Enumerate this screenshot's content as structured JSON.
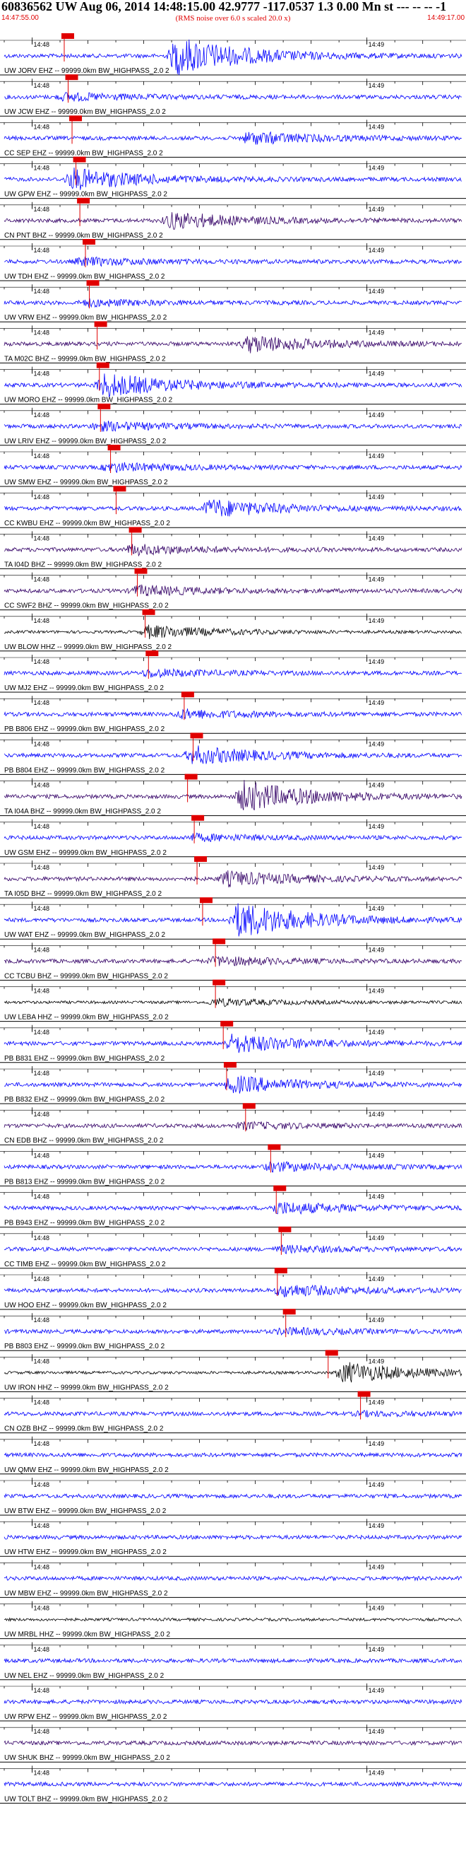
{
  "header": {
    "title": "60836562 UW Aug 06, 2014 14:48:15.00   42.9777 -117.0537  1.3 0.00 Mn st --- -- --  -1",
    "subtitle": "(RMS noise over 6.0 s scaled 20.0 x)",
    "start_time": "14:47:55.00",
    "end_time": "14:49:17.00"
  },
  "colors": {
    "blue": "#0000ff",
    "purple": "#330066",
    "black": "#000000",
    "pick": "#e00000"
  },
  "chart_data": {
    "type": "line",
    "title": "60836562 UW Aug 06, 2014 14:48:15.00   42.9777 -117.0537  1.3 0.00 Mn st --- -- --  -1",
    "subtitle": "(RMS noise over 6.0 s scaled 20.0 x)",
    "x_start": "14:47:55.00",
    "x_end": "14:49:17.00",
    "x_duration_s": 82,
    "minute_labels": [
      "14:48",
      "14:49"
    ],
    "traces": [
      {
        "label": "UW JORV EHZ -- 99999.0km BW_HIGHPASS_2.0 2",
        "color": "blue",
        "pick_s": 10.5,
        "event_s": 31,
        "event_amp": 3.2
      },
      {
        "label": "UW JCW EHZ -- 99999.0km BW_HIGHPASS_2.0 2",
        "color": "blue",
        "pick_s": 11.2,
        "event_s": 11,
        "event_amp": 0.6
      },
      {
        "label": "CC SEP EHZ -- 99999.0km BW_HIGHPASS_2.0 2",
        "color": "blue",
        "pick_s": 11.9,
        "event_s": 44,
        "event_amp": 1.0
      },
      {
        "label": "UW GPW EHZ -- 99999.0km BW_HIGHPASS_2.0 2",
        "color": "blue",
        "pick_s": 12.6,
        "event_s": 12.5,
        "event_amp": 1.8
      },
      {
        "label": "CN PNT BHZ -- 99999.0km BW_HIGHPASS_2.0 2",
        "color": "purple",
        "pick_s": 13.3,
        "event_s": 30,
        "event_amp": 1.4
      },
      {
        "label": "UW TDH EHZ -- 99999.0km BW_HIGHPASS_2.0 2",
        "color": "blue",
        "pick_s": 14.3,
        "event_s": 14,
        "event_amp": 0.6
      },
      {
        "label": "UW VRW EHZ -- 99999.0km BW_HIGHPASS_2.0 2",
        "color": "blue",
        "pick_s": 15.0,
        "event_s": 15,
        "event_amp": 0.5
      },
      {
        "label": "TA M02C BHZ -- 99999.0km BW_HIGHPASS_2.0 2",
        "color": "purple",
        "pick_s": 16.4,
        "event_s": 44,
        "event_amp": 1.4
      },
      {
        "label": "UW MORO EHZ -- 99999.0km BW_HIGHPASS_2.0 2",
        "color": "blue",
        "pick_s": 16.8,
        "event_s": 18,
        "event_amp": 2.0
      },
      {
        "label": "UW LRIV EHZ -- 99999.0km BW_HIGHPASS_2.0 2",
        "color": "blue",
        "pick_s": 17.0,
        "event_s": 17,
        "event_amp": 0.7
      },
      {
        "label": "UW SMW EHZ -- 99999.0km BW_HIGHPASS_2.0 2",
        "color": "blue",
        "pick_s": 18.8,
        "event_s": 19,
        "event_amp": 0.7
      },
      {
        "label": "CC KWBU EHZ -- 99999.0km BW_HIGHPASS_2.0 2",
        "color": "blue",
        "pick_s": 19.8,
        "event_s": 37,
        "event_amp": 1.5
      },
      {
        "label": "TA I04D BHZ -- 99999.0km BW_HIGHPASS_2.0 2",
        "color": "purple",
        "pick_s": 22.6,
        "event_s": 23,
        "event_amp": 0.8
      },
      {
        "label": "CC SWF2 BHZ -- 99999.0km BW_HIGHPASS_2.0 2",
        "color": "purple",
        "pick_s": 23.6,
        "event_s": 24,
        "event_amp": 0.8
      },
      {
        "label": "UW BLOW HHZ -- 99999.0km BW_HIGHPASS_2.0 2",
        "color": "black",
        "pick_s": 25.0,
        "event_s": 26,
        "event_amp": 1.1
      },
      {
        "label": "UW MJ2 EHZ -- 99999.0km BW_HIGHPASS_2.0 2",
        "color": "blue",
        "pick_s": 25.6,
        "event_s": 26,
        "event_amp": 0.6
      },
      {
        "label": "PB B806 EHZ -- 99999.0km BW_HIGHPASS_2.0 2",
        "color": "blue",
        "pick_s": 32.0,
        "event_s": 32,
        "event_amp": 0.7
      },
      {
        "label": "PB B804 EHZ -- 99999.0km BW_HIGHPASS_2.0 2",
        "color": "blue",
        "pick_s": 33.6,
        "event_s": 34,
        "event_amp": 1.5
      },
      {
        "label": "TA I04A BHZ -- 99999.0km BW_HIGHPASS_2.0 2",
        "color": "purple",
        "pick_s": 32.6,
        "event_s": 43,
        "event_amp": 2.6
      },
      {
        "label": "UW GSM EHZ -- 99999.0km BW_HIGHPASS_2.0 2",
        "color": "blue",
        "pick_s": 33.8,
        "event_s": 34,
        "event_amp": 0.5
      },
      {
        "label": "TA I05D BHZ -- 99999.0km BW_HIGHPASS_2.0 2",
        "color": "purple",
        "pick_s": 34.3,
        "event_s": 40,
        "event_amp": 1.2
      },
      {
        "label": "UW WAT EHZ -- 99999.0km BW_HIGHPASS_2.0 2",
        "color": "blue",
        "pick_s": 35.3,
        "event_s": 42,
        "event_amp": 3.0
      },
      {
        "label": "CC TCBU BHZ -- 99999.0km BW_HIGHPASS_2.0 2",
        "color": "purple",
        "pick_s": 37.6,
        "event_s": 38,
        "event_amp": 0.7
      },
      {
        "label": "UW LEBA HHZ -- 99999.0km BW_HIGHPASS_2.0 2",
        "color": "black",
        "pick_s": 37.6,
        "event_s": 38,
        "event_amp": 0.6
      },
      {
        "label": "PB B831 EHZ -- 99999.0km BW_HIGHPASS_2.0 2",
        "color": "blue",
        "pick_s": 39.0,
        "event_s": 41,
        "event_amp": 1.6
      },
      {
        "label": "PB B832 EHZ -- 99999.0km BW_HIGHPASS_2.0 2",
        "color": "blue",
        "pick_s": 39.6,
        "event_s": 41,
        "event_amp": 1.4
      },
      {
        "label": "CN EDB BHZ -- 99999.0km BW_HIGHPASS_2.0 2",
        "color": "purple",
        "pick_s": 43.0,
        "event_s": 43,
        "event_amp": 0.5
      },
      {
        "label": "PB B813 EHZ -- 99999.0km BW_HIGHPASS_2.0 2",
        "color": "blue",
        "pick_s": 47.5,
        "event_s": 48,
        "event_amp": 0.7
      },
      {
        "label": "PB B943 EHZ -- 99999.0km BW_HIGHPASS_2.0 2",
        "color": "blue",
        "pick_s": 48.5,
        "event_s": 49,
        "event_amp": 1.0
      },
      {
        "label": "CC TIMB EHZ -- 99999.0km BW_HIGHPASS_2.0 2",
        "color": "blue",
        "pick_s": 49.4,
        "event_s": 50,
        "event_amp": 0.5
      },
      {
        "label": "UW HOO EHZ -- 99999.0km BW_HIGHPASS_2.0 2",
        "color": "blue",
        "pick_s": 48.7,
        "event_s": 50,
        "event_amp": 1.0
      },
      {
        "label": "PB B803 EHZ -- 99999.0km BW_HIGHPASS_2.0 2",
        "color": "blue",
        "pick_s": 50.2,
        "event_s": 50,
        "event_amp": 0.5
      },
      {
        "label": "UW IRON HHZ -- 99999.0km BW_HIGHPASS_2.0 2",
        "color": "black",
        "pick_s": 57.8,
        "event_s": 61,
        "event_amp": 1.8
      },
      {
        "label": "CN OZB BHZ -- 99999.0km BW_HIGHPASS_2.0 2",
        "color": "blue",
        "pick_s": 63.6,
        "event_s": 64,
        "event_amp": 0.3
      },
      {
        "label": "UW QMW EHZ -- 99999.0km BW_HIGHPASS_2.0 2",
        "color": "blue",
        "pick_s": null,
        "event_s": null,
        "event_amp": 0
      },
      {
        "label": "UW BTW EHZ -- 99999.0km BW_HIGHPASS_2.0 2",
        "color": "blue",
        "pick_s": null,
        "event_s": null,
        "event_amp": 0
      },
      {
        "label": "UW HTW EHZ -- 99999.0km BW_HIGHPASS_2.0 2",
        "color": "blue",
        "pick_s": null,
        "event_s": null,
        "event_amp": 0
      },
      {
        "label": "UW MBW EHZ -- 99999.0km BW_HIGHPASS_2.0 2",
        "color": "blue",
        "pick_s": null,
        "event_s": null,
        "event_amp": 0
      },
      {
        "label": "UW MRBL HHZ -- 99999.0km BW_HIGHPASS_2.0 2",
        "color": "black",
        "pick_s": null,
        "event_s": null,
        "event_amp": 0
      },
      {
        "label": "UW NEL EHZ -- 99999.0km BW_HIGHPASS_2.0 2",
        "color": "blue",
        "pick_s": null,
        "event_s": null,
        "event_amp": 0
      },
      {
        "label": "UW RPW EHZ -- 99999.0km BW_HIGHPASS_2.0 2",
        "color": "blue",
        "pick_s": null,
        "event_s": null,
        "event_amp": 0
      },
      {
        "label": "UW SHUK BHZ -- 99999.0km BW_HIGHPASS_2.0 2",
        "color": "purple",
        "pick_s": null,
        "event_s": null,
        "event_amp": 0
      },
      {
        "label": "UW TOLT BHZ -- 99999.0km BW_HIGHPASS_2.0 2",
        "color": "blue",
        "pick_s": null,
        "event_s": null,
        "event_amp": 0
      }
    ]
  }
}
